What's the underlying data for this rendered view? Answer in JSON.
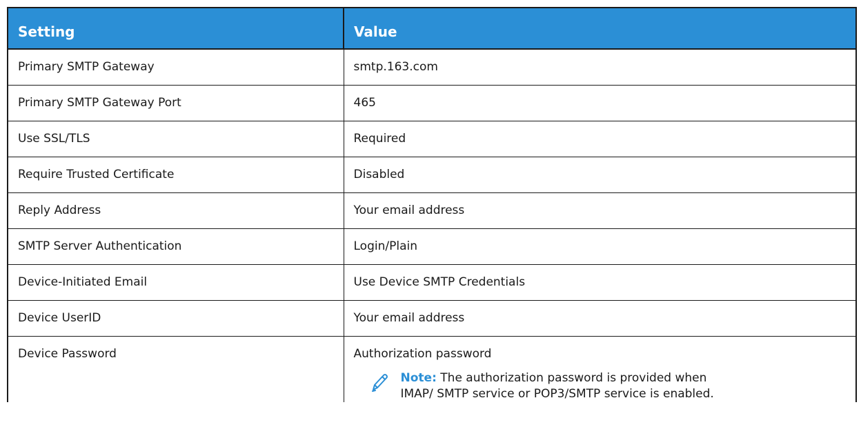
{
  "table": {
    "header": {
      "setting": "Setting",
      "value": "Value"
    },
    "rows": [
      {
        "setting": "Primary SMTP Gateway",
        "value": "smtp.163.com"
      },
      {
        "setting": "Primary SMTP Gateway Port",
        "value": "465"
      },
      {
        "setting": "Use SSL/TLS",
        "value": "Required"
      },
      {
        "setting": "Require Trusted Certificate",
        "value": "Disabled"
      },
      {
        "setting": "Reply Address",
        "value": "Your email address"
      },
      {
        "setting": "SMTP Server Authentication",
        "value": "Login/Plain"
      },
      {
        "setting": "Device-Initiated Email",
        "value": "Use Device SMTP Credentials"
      },
      {
        "setting": "Device UserID",
        "value": "Your email address"
      },
      {
        "setting": "Device Password",
        "value": "Authorization password"
      }
    ],
    "note": {
      "label": "Note:",
      "text": " The authorization password is provided when IMAP/ SMTP service or POP3/SMTP service is enabled.",
      "icon": "pencil-icon"
    }
  },
  "colors": {
    "header_bg": "#2b8fd6",
    "header_text": "#ffffff",
    "note_label": "#2b8fd6",
    "border": "#1a1a1a"
  }
}
